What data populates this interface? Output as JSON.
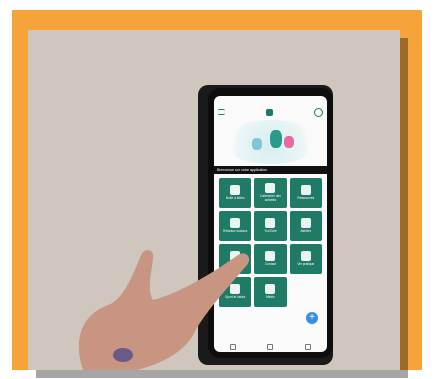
{
  "phone": {
    "banner": "Bienvenue sur votre application",
    "tiles": [
      {
        "label": "Boîte à idées",
        "icon": "building-icon"
      },
      {
        "label": "Calendrier des activités",
        "icon": "calendar-icon"
      },
      {
        "label": "Ressources",
        "icon": "location-pin-icon"
      },
      {
        "label": "Réseaux sociaux",
        "icon": "hands-icon"
      },
      {
        "label": "YouTube",
        "icon": "play-icon"
      },
      {
        "label": "Ateliers",
        "icon": "cup-icon"
      },
      {
        "label": "Événements",
        "icon": "people-icon"
      },
      {
        "label": "Contact",
        "icon": "chat-icon"
      },
      {
        "label": "Vie pratique",
        "icon": "grid-icon"
      },
      {
        "label": "Sport et loisirs",
        "icon": "ball-icon"
      },
      {
        "label": "Météo",
        "icon": "sun-icon"
      }
    ],
    "fab": "+"
  }
}
